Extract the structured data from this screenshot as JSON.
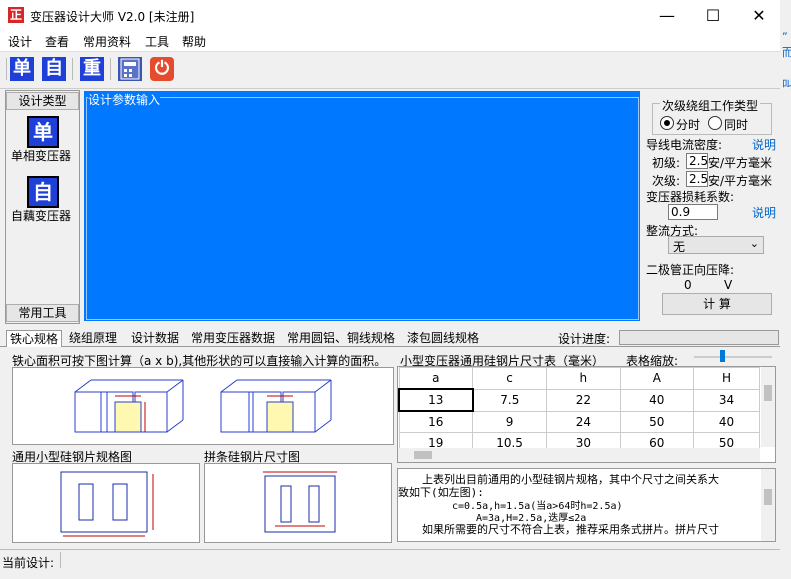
{
  "window": {
    "title": "变压器设计大师  V2.0   [未注册]",
    "app_icon_char": "正"
  },
  "menu": [
    "设计",
    "查看",
    "常用资料",
    "工具",
    "帮助"
  ],
  "toolbar": {
    "btn1": "单",
    "btn2": "自",
    "btn3": "重",
    "btn5": "⏻"
  },
  "left_panel": {
    "design_type": "设计类型",
    "single_icon": "单",
    "single_label": "单相变压器",
    "auto_icon": "自",
    "auto_label": "自藕变压器",
    "common_tools": "常用工具"
  },
  "main": {
    "caption": "设计参数输入"
  },
  "right_panel": {
    "group_title": "次级绕组工作类型",
    "radio1": "分时",
    "radio2": "同时",
    "current_density_label": "导线电流密度:",
    "explain1": "说明",
    "primary_label": "初级:",
    "primary_value": "2.5",
    "unit1": "安/平方毫米",
    "secondary_label": "次级:",
    "secondary_value": "2.5",
    "unit2": "安/平方毫米",
    "loss_label": "变压器损耗系数:",
    "loss_value": "0.9",
    "explain2": "说明",
    "rectify_label": "整流方式:",
    "rectify_value": "无",
    "diode_label": "二极管正向压降:",
    "diode_value": "0",
    "diode_unit": "V",
    "calc_button": "计  算"
  },
  "tabs": [
    "铁心规格",
    "绕组原理",
    "设计数据",
    "常用变压器数据",
    "常用圆铝、铜线规格",
    "漆包圆线规格"
  ],
  "progress_label": "设计进度:",
  "lower": {
    "core_area_text": "铁心面积可按下图计算（a x b),其他形状的可以直接输入计算的面积。",
    "table_title": "小型变压器通用硅钢片尺寸表（毫米）",
    "zoom_label": "表格缩放:",
    "columns": [
      "a",
      "c",
      "h",
      "A",
      "H"
    ],
    "rows": [
      [
        "13",
        "7.5",
        "22",
        "40",
        "34"
      ],
      [
        "16",
        "9",
        "24",
        "50",
        "40"
      ],
      [
        "19",
        "10.5",
        "30",
        "60",
        "50"
      ]
    ],
    "spec_caption": "通用小型硅钢片规格图",
    "strip_caption": "拼条硅钢片尺寸图",
    "desc_line1": "上表列出目前通用的小型硅钢片规格，其中个尺寸之间关系大",
    "desc_line2": "致如下(如左图):",
    "desc_line3": "c=0.5a,h=1.5a(当a>64时h=2.5a)",
    "desc_line4": "A=3a,H=2.5a,迭厚≤2a",
    "desc_line5": "如果所需要的尺寸不符合上表，推荐采用条式拼片。拼片尺寸"
  },
  "status": {
    "label": "当前设计:"
  },
  "colors": {
    "accent_blue": "#0078ff",
    "icon_red": "#d8262b",
    "icon_blue": "#1e3fd8"
  }
}
